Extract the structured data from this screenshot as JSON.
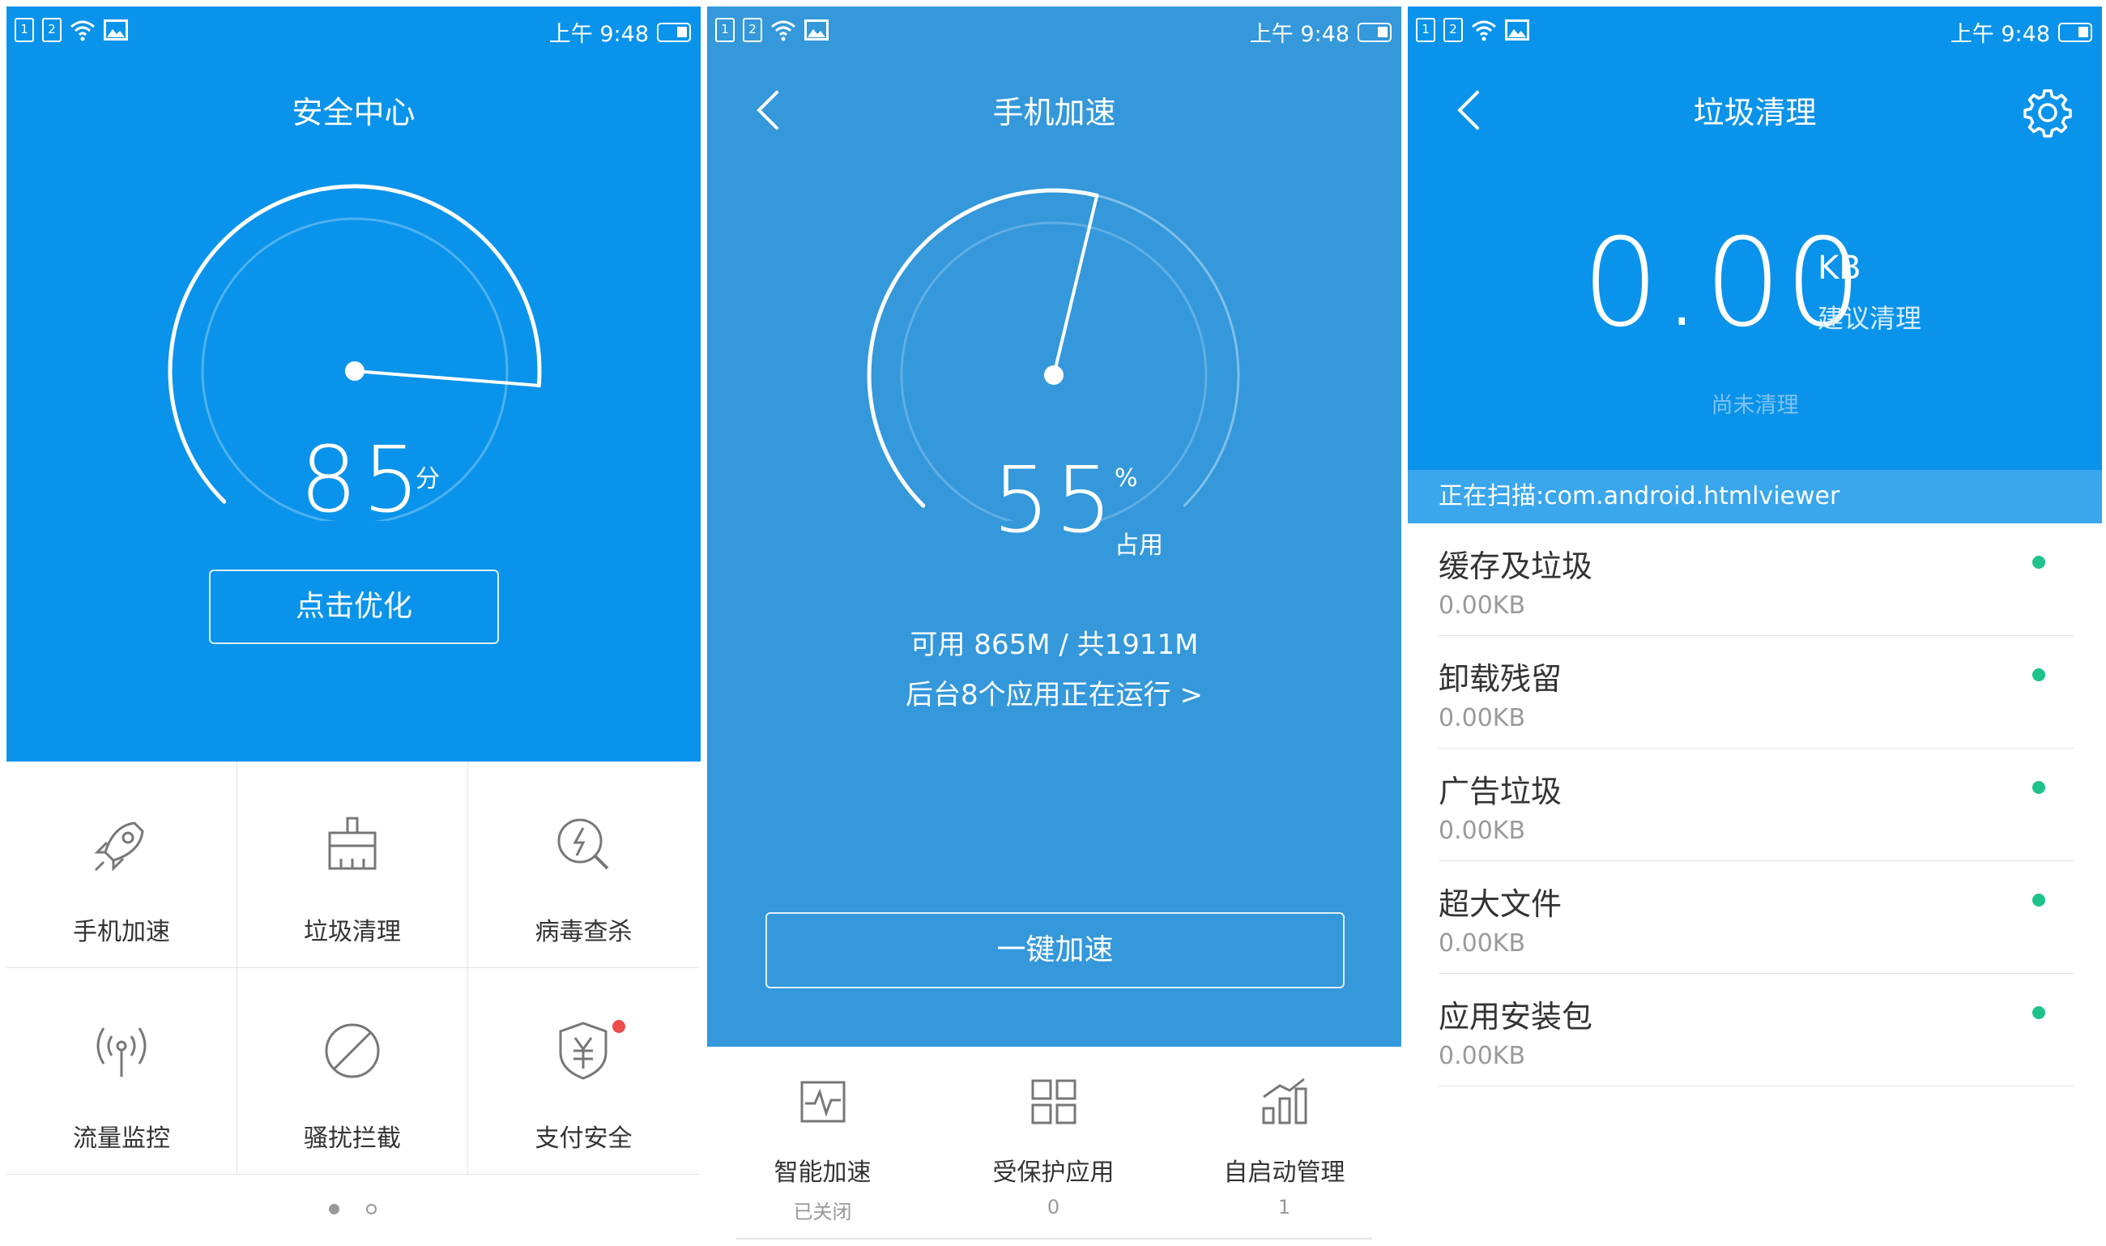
{
  "status_bar": {
    "time": "上午 9:48",
    "sim1": "1",
    "sim2": "2"
  },
  "colors": {
    "primary": "#0a93ea",
    "speed_bg": "#3498db",
    "status_dot": "#1ec28b",
    "badge": "#ee4b4b"
  },
  "security_center": {
    "title": "安全中心",
    "score": "85",
    "score_unit": "分",
    "score_value": 85,
    "optimize_button": "点击优化",
    "tiles": [
      {
        "label": "手机加速",
        "icon": "rocket-icon"
      },
      {
        "label": "垃圾清理",
        "icon": "broom-icon"
      },
      {
        "label": "病毒查杀",
        "icon": "virus-scan-icon"
      },
      {
        "label": "流量监控",
        "icon": "antenna-icon"
      },
      {
        "label": "骚扰拦截",
        "icon": "block-icon"
      },
      {
        "label": "支付安全",
        "icon": "payment-shield-icon"
      }
    ],
    "page_index": 1,
    "page_count": 2
  },
  "phone_speedup": {
    "title": "手机加速",
    "usage": "55",
    "usage_percent": 55,
    "usage_unit": "%",
    "usage_label": "占用",
    "memory_text": "可用 865M / 共1911M",
    "background_text": "后台8个应用正在运行 >",
    "boost_button": "一键加速",
    "bottom_items": [
      {
        "label": "智能加速",
        "sub": "已关闭",
        "icon": "pulse-icon"
      },
      {
        "label": "受保护应用",
        "sub": "0",
        "icon": "grid-icon"
      },
      {
        "label": "自启动管理",
        "sub": "1",
        "icon": "bar-chart-icon"
      }
    ]
  },
  "junk_clean": {
    "title": "垃圾清理",
    "size": "0.00",
    "size_unit": "KB",
    "suggestion": "建议清理",
    "status": "尚未清理",
    "scanning": "正在扫描:com.android.htmlviewer",
    "items": [
      {
        "title": "缓存及垃圾",
        "size": "0.00KB"
      },
      {
        "title": "卸载残留",
        "size": "0.00KB"
      },
      {
        "title": "广告垃圾",
        "size": "0.00KB"
      },
      {
        "title": "超大文件",
        "size": "0.00KB"
      },
      {
        "title": "应用安装包",
        "size": "0.00KB"
      }
    ]
  }
}
